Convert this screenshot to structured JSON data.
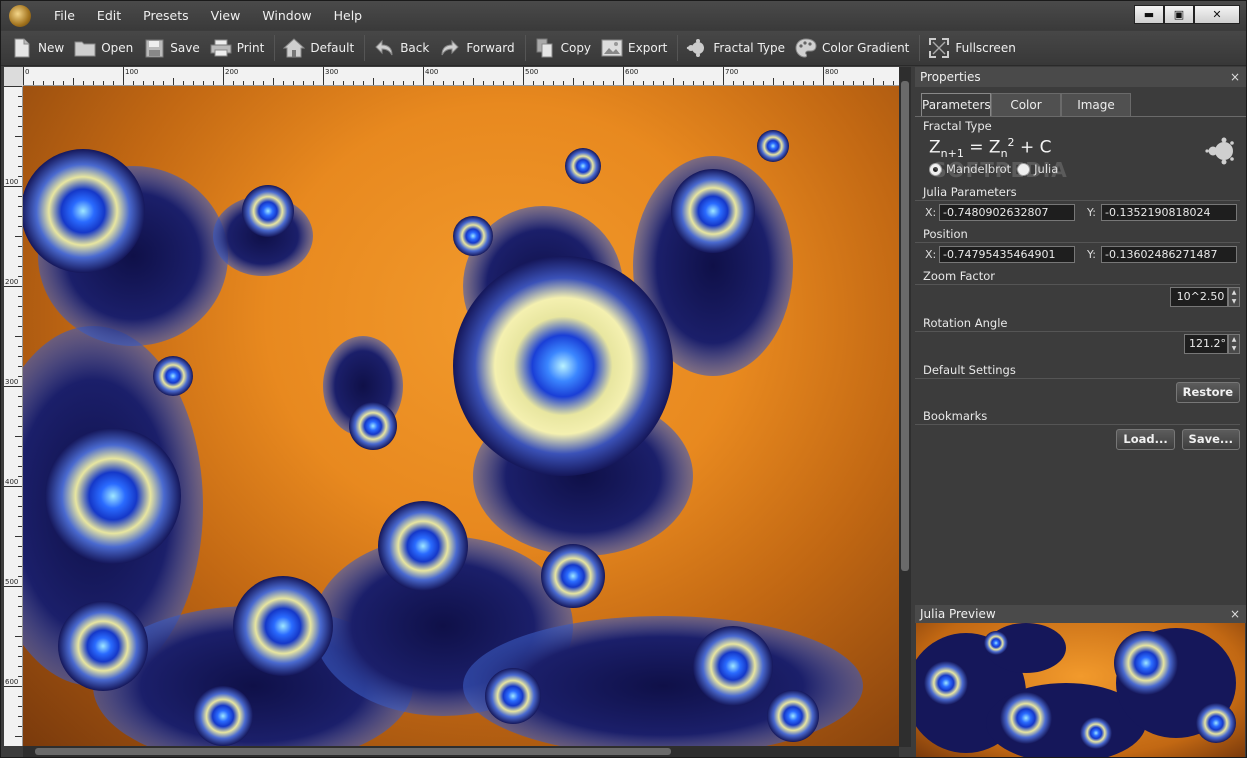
{
  "menubar": {
    "items": [
      "File",
      "Edit",
      "Presets",
      "View",
      "Window",
      "Help"
    ]
  },
  "window_controls": {
    "minimize": "▬",
    "maximize": "▣",
    "close": "✕"
  },
  "toolbar": {
    "new": "New",
    "open": "Open",
    "save": "Save",
    "print": "Print",
    "default": "Default",
    "back": "Back",
    "forward": "Forward",
    "copy": "Copy",
    "export": "Export",
    "fractal_type": "Fractal Type",
    "color_gradient": "Color Gradient",
    "fullscreen": "Fullscreen"
  },
  "ruler": {
    "top": [
      "0",
      "100",
      "200",
      "300",
      "400",
      "500",
      "600",
      "700",
      "800"
    ],
    "left": [
      "100",
      "200",
      "300",
      "400",
      "500",
      "600"
    ]
  },
  "properties": {
    "title": "Properties",
    "close": "×",
    "tabs": [
      "Parameters",
      "Color",
      "Image"
    ],
    "active_tab": "Parameters",
    "fractal_type_label": "Fractal Type",
    "formula": {
      "lhs": "Z",
      "lhs_sub": "n+1",
      "eq": " = ",
      "rhs": "Z",
      "rhs_sub": "n",
      "rhs_sup": "2",
      "plus": " + C"
    },
    "mandelbrot_label": "Mandelbrot",
    "julia_label": "Julia",
    "selected_type": "Mandelbrot",
    "julia_params_label": "Julia Parameters",
    "julia_x_label": "X:",
    "julia_x": "-0.7480902632807",
    "julia_y_label": "Y:",
    "julia_y": "-0.1352190818024",
    "position_label": "Position",
    "pos_x_label": "X:",
    "pos_x": "-0.74795435464901",
    "pos_y_label": "Y:",
    "pos_y": "-0.13602486271487",
    "zoom_label": "Zoom Factor",
    "zoom": "10^2.50",
    "rotation_label": "Rotation Angle",
    "rotation": "121.2°",
    "default_settings_label": "Default Settings",
    "restore_button": "Restore",
    "bookmarks_label": "Bookmarks",
    "load_button": "Load...",
    "save_button": "Save...",
    "watermark": "SOFTPEDIA"
  },
  "julia_preview": {
    "title": "Julia Preview",
    "close": "×"
  },
  "colors": {
    "fractal_orange": "#f29a2c",
    "fractal_navy": "#15175a",
    "fractal_blue": "#2a6bff",
    "fractal_cream": "#e8e6a0"
  }
}
